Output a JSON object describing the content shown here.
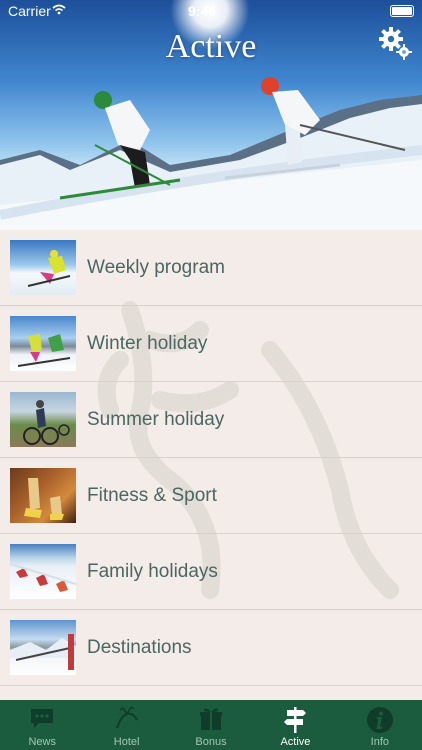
{
  "status_bar": {
    "carrier": "Carrier",
    "time": "9:46"
  },
  "header": {
    "title": "Active"
  },
  "list": {
    "items": [
      {
        "label": "Weekly program"
      },
      {
        "label": "Winter holiday"
      },
      {
        "label": "Summer holiday"
      },
      {
        "label": "Fitness & Sport"
      },
      {
        "label": "Family holidays"
      },
      {
        "label": "Destinations"
      }
    ]
  },
  "tab_bar": {
    "items": [
      {
        "label": "News",
        "icon": "chat-bubble-icon"
      },
      {
        "label": "Hotel",
        "icon": "deer-icon"
      },
      {
        "label": "Bonus",
        "icon": "gift-icon"
      },
      {
        "label": "Active",
        "icon": "signpost-icon"
      },
      {
        "label": "Info",
        "icon": "info-icon"
      }
    ],
    "active": "Active"
  },
  "colors": {
    "tab_bar_bg": "#1b5c3f",
    "list_bg": "#f3ece8",
    "label_text": "#4c6661"
  }
}
